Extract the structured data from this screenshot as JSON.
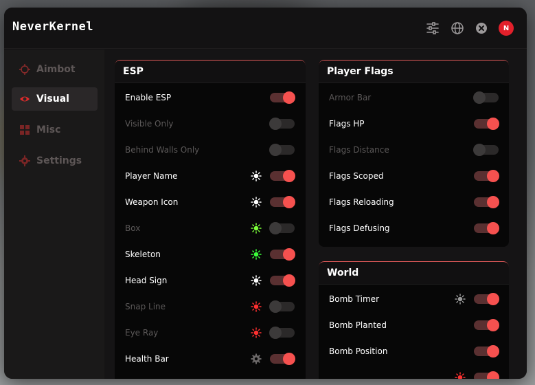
{
  "app": {
    "title": "NeverKernel"
  },
  "header": {
    "icons": [
      "sliders-icon",
      "globe-icon",
      "close-icon"
    ],
    "avatar_initial": "N"
  },
  "colors": {
    "accent": "#f6514f",
    "toggle_track_on": "#5a3031",
    "toggle_off": "#3c3a3a",
    "panel_border": "#e45b5b",
    "active_nav_bg": "#2a2728"
  },
  "sidebar": {
    "items": [
      {
        "label": "Aimbot",
        "icon": "crosshair-icon",
        "active": false
      },
      {
        "label": "Visual",
        "icon": "eye-icon",
        "active": true
      },
      {
        "label": "Misc",
        "icon": "grid-icon",
        "active": false
      },
      {
        "label": "Settings",
        "icon": "gear-icon",
        "active": false
      }
    ]
  },
  "esp": {
    "title": "ESP",
    "rows": [
      {
        "label": "Enable ESP",
        "on": true,
        "extra": null
      },
      {
        "label": "Visible Only",
        "on": false,
        "extra": null
      },
      {
        "label": "Behind Walls Only",
        "on": false,
        "extra": null
      },
      {
        "label": "Player Name",
        "on": true,
        "extra": {
          "icon": "color-sun-icon",
          "color": "#ffffff"
        }
      },
      {
        "label": "Weapon Icon",
        "on": true,
        "extra": {
          "icon": "color-sun-icon",
          "color": "#ffffff"
        }
      },
      {
        "label": "Box",
        "on": false,
        "extra": {
          "icon": "color-sun-icon",
          "color": "#7cff3a"
        }
      },
      {
        "label": "Skeleton",
        "on": true,
        "extra": {
          "icon": "color-sun-icon",
          "color": "#3aff3a"
        }
      },
      {
        "label": "Head Sign",
        "on": true,
        "extra": {
          "icon": "color-sun-icon",
          "color": "#ffffff"
        }
      },
      {
        "label": "Snap Line",
        "on": false,
        "extra": {
          "icon": "color-sun-icon",
          "color": "#ff3030"
        }
      },
      {
        "label": "Eye Ray",
        "on": false,
        "extra": {
          "icon": "color-sun-icon",
          "color": "#ff3030"
        }
      },
      {
        "label": "Health Bar",
        "on": true,
        "extra": {
          "icon": "gear-icon",
          "color": "#6b6868"
        }
      }
    ]
  },
  "player_flags": {
    "title": "Player Flags",
    "rows": [
      {
        "label": "Armor Bar",
        "on": false
      },
      {
        "label": "Flags HP",
        "on": true
      },
      {
        "label": "Flags Distance",
        "on": false
      },
      {
        "label": "Flags Scoped",
        "on": true
      },
      {
        "label": "Flags Reloading",
        "on": true
      },
      {
        "label": "Flags Defusing",
        "on": true
      }
    ]
  },
  "world": {
    "title": "World",
    "rows": [
      {
        "label": "Bomb Timer",
        "on": true,
        "extra": {
          "icon": "color-sun-icon",
          "color": "#9a9a9a"
        }
      },
      {
        "label": "Bomb Planted",
        "on": true,
        "extra": null
      },
      {
        "label": "Bomb Position",
        "on": true,
        "extra": null
      },
      {
        "label": "",
        "on": true,
        "extra": {
          "icon": "color-sun-icon",
          "color": "#ff3030"
        }
      }
    ]
  }
}
